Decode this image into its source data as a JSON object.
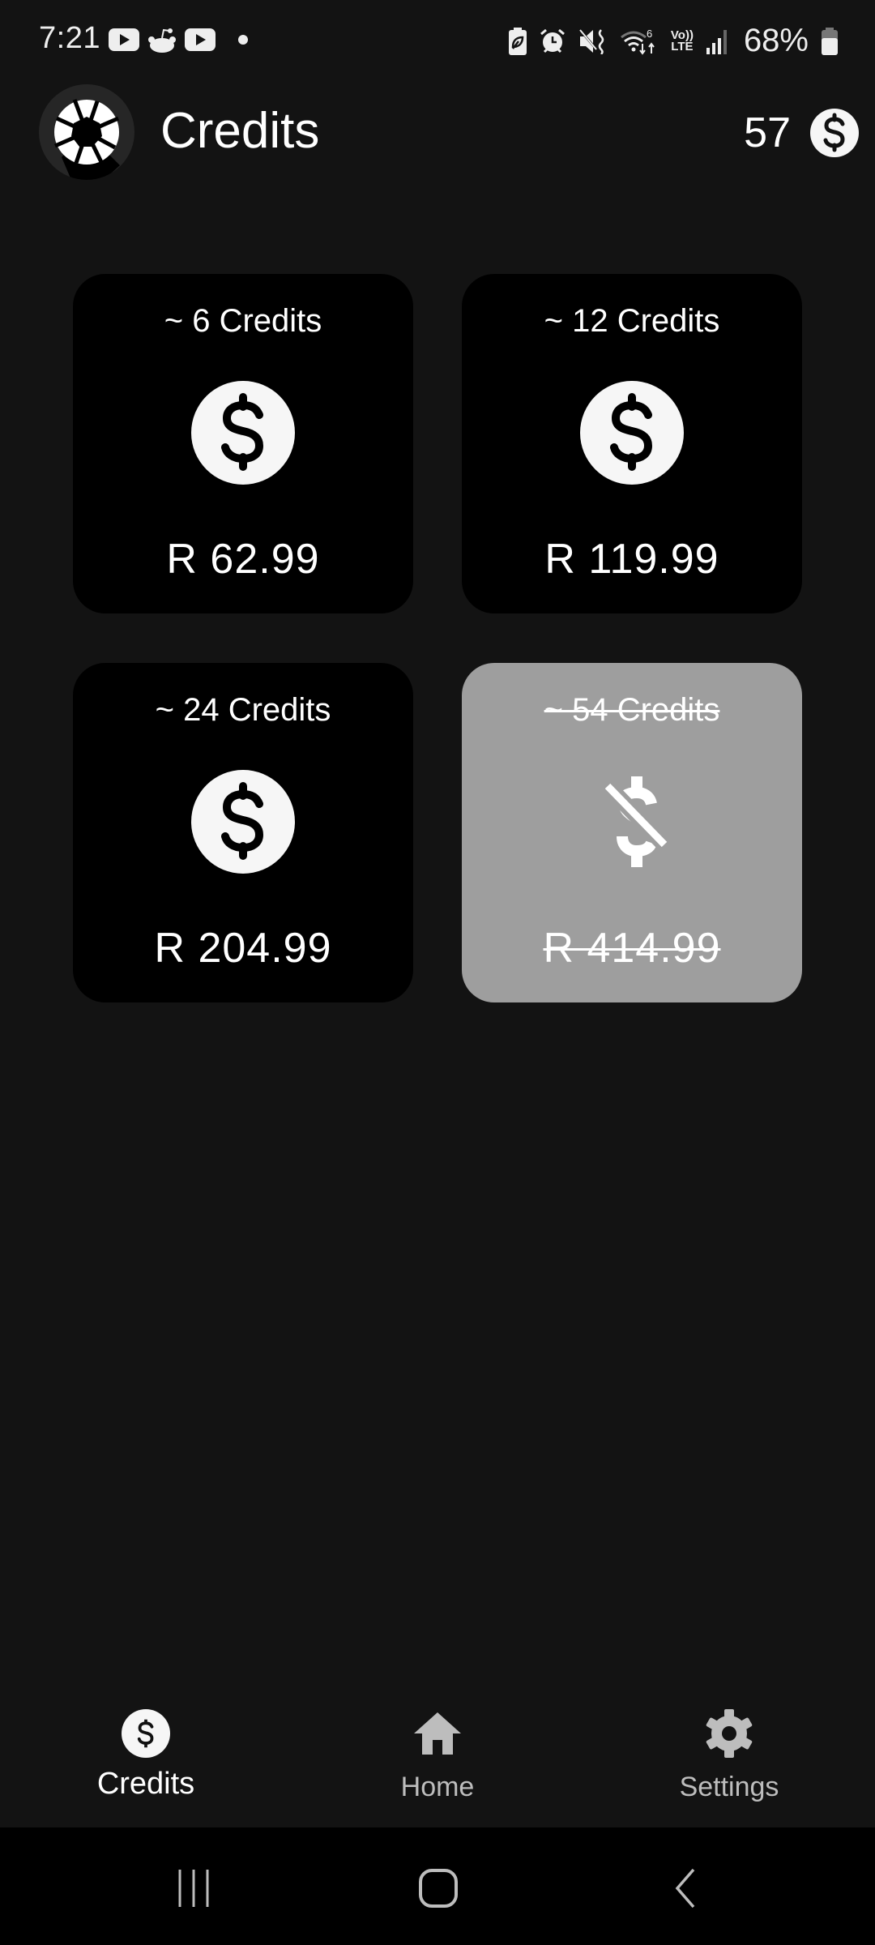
{
  "status_bar": {
    "time": "7:21",
    "notification_icons": [
      "youtube-icon",
      "reddit-icon",
      "youtube-icon",
      "more-dot-icon"
    ],
    "system_icons": [
      "battery-saver-icon",
      "alarm-icon",
      "mute-vibrate-icon",
      "wifi-6-icon",
      "volte-icon",
      "signal-icon"
    ],
    "wifi_label": "6",
    "volte_top": "Vo))",
    "volte_bottom": "LTE",
    "battery_percent": "68%"
  },
  "app_bar": {
    "logo_icon": "aperture-logo-icon",
    "title": "Credits",
    "balance": "57",
    "balance_icon": "dollar-coin-icon"
  },
  "packages": [
    {
      "credits": "~ 6 Credits",
      "price": "R 62.99",
      "icon": "dollar-coin-icon",
      "available": true
    },
    {
      "credits": "~ 12 Credits",
      "price": "R 119.99",
      "icon": "dollar-coin-icon",
      "available": true
    },
    {
      "credits": "~ 24 Credits",
      "price": "R 204.99",
      "icon": "dollar-coin-icon",
      "available": true
    },
    {
      "credits": "~ 54 Credits",
      "price": "R 414.99",
      "icon": "money-off-icon",
      "available": false
    }
  ],
  "bottom_nav": {
    "items": [
      {
        "label": "Credits",
        "icon": "dollar-coin-icon",
        "active": true
      },
      {
        "label": "Home",
        "icon": "home-icon",
        "active": false
      },
      {
        "label": "Settings",
        "icon": "gear-icon",
        "active": false
      }
    ]
  },
  "system_nav": [
    "recent-apps-icon",
    "home-circle-icon",
    "back-icon"
  ],
  "colors": {
    "background": "#131313",
    "card": "#000000",
    "card_disabled": "#9e9e9e",
    "text": "#ffffff",
    "inactive_nav": "#bdbdbd"
  }
}
